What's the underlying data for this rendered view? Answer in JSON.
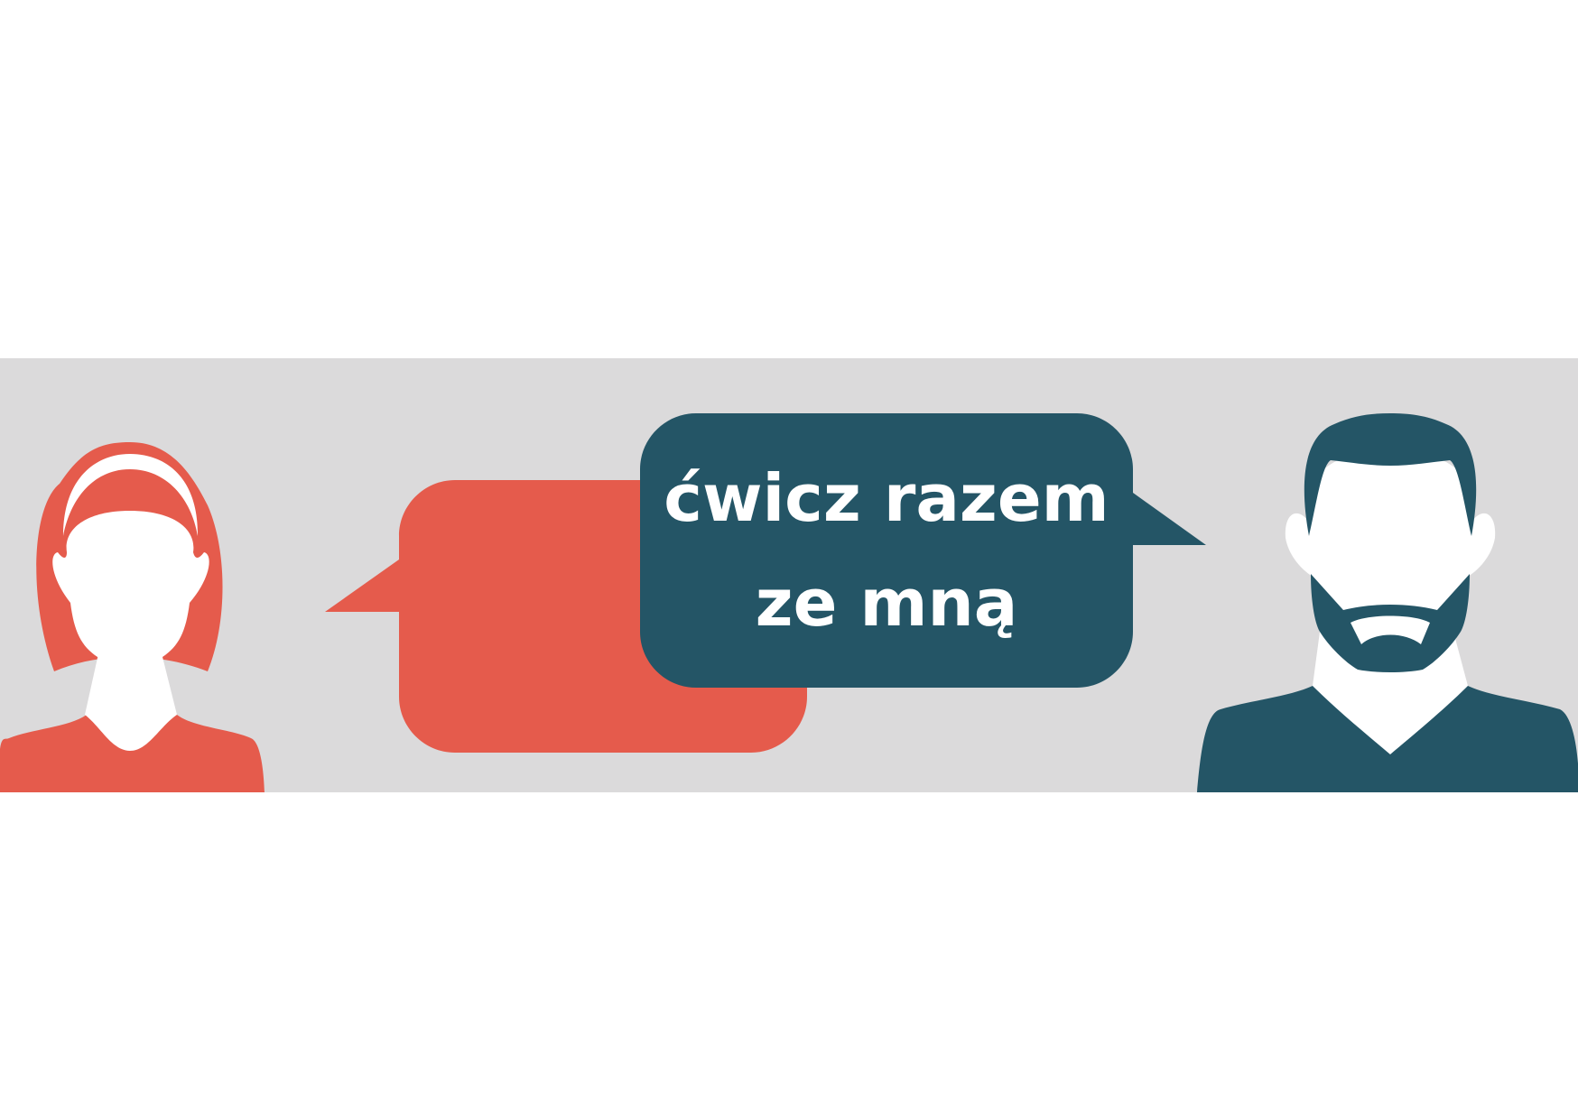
{
  "message": {
    "line1": "ćwicz razem",
    "line2": "ze mną"
  },
  "colors": {
    "background": "#ffffff",
    "band": "#dbdadb",
    "accent_red": "#e55b4c",
    "accent_teal": "#245566",
    "skin": "#ffffff",
    "text": "#ffffff"
  },
  "icons": {
    "left_person": "woman-avatar-icon",
    "right_person": "man-avatar-icon",
    "left_bubble": "speech-bubble-icon",
    "right_bubble": "speech-bubble-icon"
  }
}
